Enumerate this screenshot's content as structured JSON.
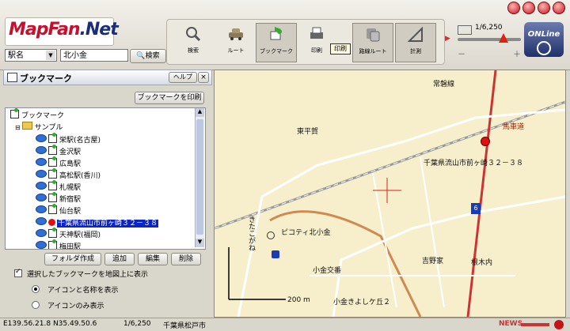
{
  "app": {
    "logo_text_a": "MapFan",
    "logo_text_b": ".Net"
  },
  "toolbar": {
    "tools": [
      {
        "label": "検索",
        "icon": "magnifier-icon"
      },
      {
        "label": "ルート",
        "icon": "car-icon"
      },
      {
        "label": "ブックマーク",
        "icon": "bookmark-flag-icon"
      },
      {
        "label": "印刷",
        "icon": "printer-icon"
      },
      {
        "label": "路線ルート",
        "icon": "train-route-icon"
      },
      {
        "label": "計測",
        "icon": "ruler-icon"
      }
    ],
    "print_tooltip": "印刷",
    "scale_display": "1/6,250",
    "online_label": "ONLine"
  },
  "search": {
    "category": "駅名",
    "query": "北小金",
    "button_label": "検索"
  },
  "panel": {
    "title": "ブックマーク",
    "help_label": "ヘルプ",
    "close_label": "×",
    "print_button": "ブックマークを印刷",
    "tree": {
      "root": "ブックマーク",
      "folder": "サンプル",
      "items": [
        "栄駅(名古屋)",
        "金沢駅",
        "広島駅",
        "高松駅(香川)",
        "札幌駅",
        "新宿駅",
        "仙台駅",
        "千葉県流山市前ヶ崎３２－３８",
        "天神駅(福岡)",
        "梅田駅"
      ],
      "selected_index": 7
    },
    "buttons": [
      "フォルダ作成",
      "追加",
      "編集",
      "削除"
    ],
    "show_on_map_label": "選択したブックマークを地図上に表示",
    "show_on_map_checked": true,
    "radio_options": [
      "アイコンと名称を表示",
      "アイコンのみ表示"
    ],
    "radio_selected": 0
  },
  "map": {
    "labels": [
      "常磐線",
      "東平賀",
      "馬車道",
      "千葉県流山市前ヶ崎３２－３８",
      "6",
      "きたこがね",
      "ピコティ北小金",
      "吉野家",
      "根木内",
      "小金交番",
      "小金きよしケ丘２",
      "200 m"
    ]
  },
  "status": {
    "coords": "E139.56.21.8  N35.49.50.6",
    "scale": "1/6,250",
    "location": "千葉県松戸市",
    "news": "NEWS"
  }
}
